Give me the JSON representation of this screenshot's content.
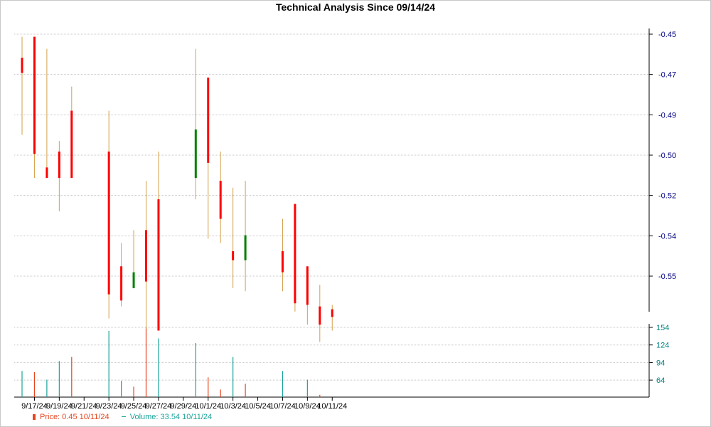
{
  "title": "Technical Analysis Since 09/14/24",
  "legend": {
    "price_label": "Price: 0.45  10/11/24",
    "volume_label": "Volume: 33.54  10/11/24"
  },
  "colors": {
    "up": "#008000",
    "down": "#ff0000",
    "wick": "#d4a04a",
    "volume_up": "#1aa39a",
    "volume_down": "#e8451e",
    "price_axis_text": "#000080",
    "volume_axis_text": "#008080",
    "grid": "#c8c8c8"
  },
  "chart_data": [
    {
      "type": "candlestick",
      "title": "Technical Analysis Since 09/14/24",
      "x_tick_labels": [
        "9/17/24",
        "9/19/24",
        "9/21/24",
        "9/23/24",
        "9/25/24",
        "9/27/24",
        "9/29/24",
        "10/1/24",
        "10/3/24",
        "10/5/24",
        "10/7/24",
        "10/9/24",
        "10/11/24"
      ],
      "y_tick_labels": [
        "-0.45",
        "-0.47",
        "-0.49",
        "-0.50",
        "-0.52",
        "-0.54",
        "-0.55"
      ],
      "ylim": [
        -0.56,
        -0.45
      ],
      "grid": true,
      "candles": [
        {
          "date": "9/16/24",
          "open": -0.4592,
          "close": -0.4651,
          "high": -0.451,
          "low": -0.4892
        },
        {
          "date": "9/17/24",
          "open": -0.451,
          "close": -0.4966,
          "high": -0.451,
          "low": -0.506
        },
        {
          "date": "9/18/24",
          "open": -0.5019,
          "close": -0.506,
          "high": -0.4557,
          "low": -0.506
        },
        {
          "date": "9/19/24",
          "open": -0.4957,
          "close": -0.506,
          "high": -0.4916,
          "low": -0.519
        },
        {
          "date": "9/20/24",
          "open": -0.4798,
          "close": -0.506,
          "high": -0.4704,
          "low": -0.506
        },
        {
          "date": "9/23/24",
          "open": -0.4957,
          "close": -0.5513,
          "high": -0.4798,
          "low": -0.5607
        },
        {
          "date": "9/24/24",
          "open": -0.5404,
          "close": -0.5537,
          "high": -0.5313,
          "low": -0.556
        },
        {
          "date": "9/25/24",
          "open": -0.5489,
          "close": -0.5427,
          "high": -0.5263,
          "low": -0.5489
        },
        {
          "date": "9/26/24",
          "open": -0.5263,
          "close": -0.5463,
          "high": -0.5071,
          "low": -0.5646
        },
        {
          "date": "9/27/24",
          "open": -0.5143,
          "close": -0.5654,
          "high": -0.4957,
          "low": -0.5654
        },
        {
          "date": "9/30/24",
          "open": -0.506,
          "close": -0.4871,
          "high": -0.4557,
          "low": -0.5143
        },
        {
          "date": "10/1/24",
          "open": -0.4669,
          "close": -0.5001,
          "high": -0.4669,
          "low": -0.5296
        },
        {
          "date": "10/2/24",
          "open": -0.5071,
          "close": -0.5219,
          "high": -0.4957,
          "low": -0.5313
        },
        {
          "date": "10/3/24",
          "open": -0.5345,
          "close": -0.538,
          "high": -0.5098,
          "low": -0.5489
        },
        {
          "date": "10/4/24",
          "open": -0.538,
          "close": -0.5283,
          "high": -0.5071,
          "low": -0.5501
        },
        {
          "date": "10/7/24",
          "open": -0.5345,
          "close": -0.5427,
          "high": -0.5219,
          "low": -0.5501
        },
        {
          "date": "10/8/24",
          "open": -0.5161,
          "close": -0.5548,
          "high": -0.5161,
          "low": -0.558
        },
        {
          "date": "10/9/24",
          "open": -0.5404,
          "close": -0.5554,
          "high": -0.5404,
          "low": -0.5631
        },
        {
          "date": "10/10/24",
          "open": -0.556,
          "close": -0.5631,
          "high": -0.5476,
          "low": -0.5698
        },
        {
          "date": "10/11/24",
          "open": -0.5571,
          "close": -0.5601,
          "high": -0.5554,
          "low": -0.5654
        }
      ]
    },
    {
      "type": "bar",
      "title": "Volume",
      "y_tick_labels": [
        "154",
        "124",
        "94",
        "64"
      ],
      "ylim": [
        34,
        154
      ],
      "grid": true,
      "bars": [
        {
          "date": "9/16/24",
          "value": 79,
          "direction": "up"
        },
        {
          "date": "9/17/24",
          "value": 77,
          "direction": "down"
        },
        {
          "date": "9/18/24",
          "value": 64,
          "direction": "up"
        },
        {
          "date": "9/19/24",
          "value": 96,
          "direction": "up"
        },
        {
          "date": "9/20/24",
          "value": 103,
          "direction": "down"
        },
        {
          "date": "9/23/24",
          "value": 148,
          "direction": "up"
        },
        {
          "date": "9/24/24",
          "value": 62,
          "direction": "up"
        },
        {
          "date": "9/25/24",
          "value": 52,
          "direction": "down"
        },
        {
          "date": "9/26/24",
          "value": 155,
          "direction": "down"
        },
        {
          "date": "9/27/24",
          "value": 135,
          "direction": "up"
        },
        {
          "date": "9/30/24",
          "value": 127,
          "direction": "up"
        },
        {
          "date": "10/1/24",
          "value": 68,
          "direction": "down"
        },
        {
          "date": "10/2/24",
          "value": 47,
          "direction": "down"
        },
        {
          "date": "10/3/24",
          "value": 103,
          "direction": "up"
        },
        {
          "date": "10/4/24",
          "value": 57,
          "direction": "down"
        },
        {
          "date": "10/7/24",
          "value": 79,
          "direction": "up"
        },
        {
          "date": "10/9/24",
          "value": 64,
          "direction": "up"
        },
        {
          "date": "10/10/24",
          "value": 38,
          "direction": "down"
        },
        {
          "date": "10/11/24",
          "value": 34,
          "direction": "down"
        }
      ]
    }
  ]
}
